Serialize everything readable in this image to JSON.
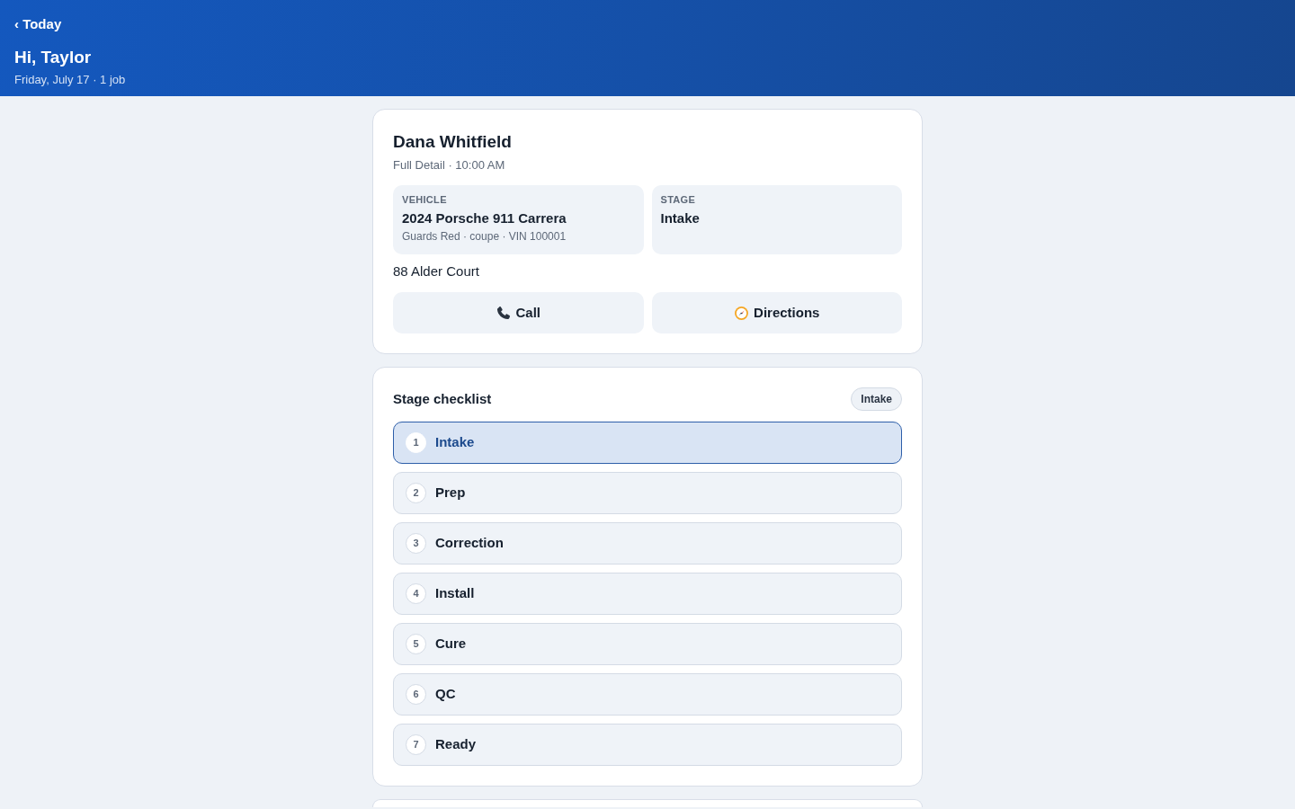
{
  "header": {
    "back_link": "‹ Today",
    "greeting": "Hi, Taylor",
    "subtitle": "Friday, July 17 · 1 job"
  },
  "job": {
    "customer": "Dana Whitfield",
    "service": "Full Detail · 10:00 AM",
    "info": [
      {
        "label": "VEHICLE",
        "value": "2024 Porsche 911 Carrera",
        "detail": "Guards Red · coupe · VIN 100001"
      },
      {
        "label": "STAGE",
        "value": "Intake"
      }
    ],
    "address": "88 Alder Court",
    "actions": [
      {
        "kind": "call",
        "label": "Call"
      },
      {
        "kind": "directions",
        "label": "Directions"
      }
    ]
  },
  "checklist": {
    "title": "Stage checklist",
    "badge": "Intake",
    "stages": [
      {
        "number": "1",
        "label": "Intake",
        "selected": true
      },
      {
        "number": "2",
        "label": "Prep",
        "selected": false
      },
      {
        "number": "3",
        "label": "Correction",
        "selected": false
      },
      {
        "number": "4",
        "label": "Install",
        "selected": false
      },
      {
        "number": "5",
        "label": "Cure",
        "selected": false
      },
      {
        "number": "6",
        "label": "QC",
        "selected": false
      },
      {
        "number": "7",
        "label": "Ready",
        "selected": false
      }
    ]
  }
}
